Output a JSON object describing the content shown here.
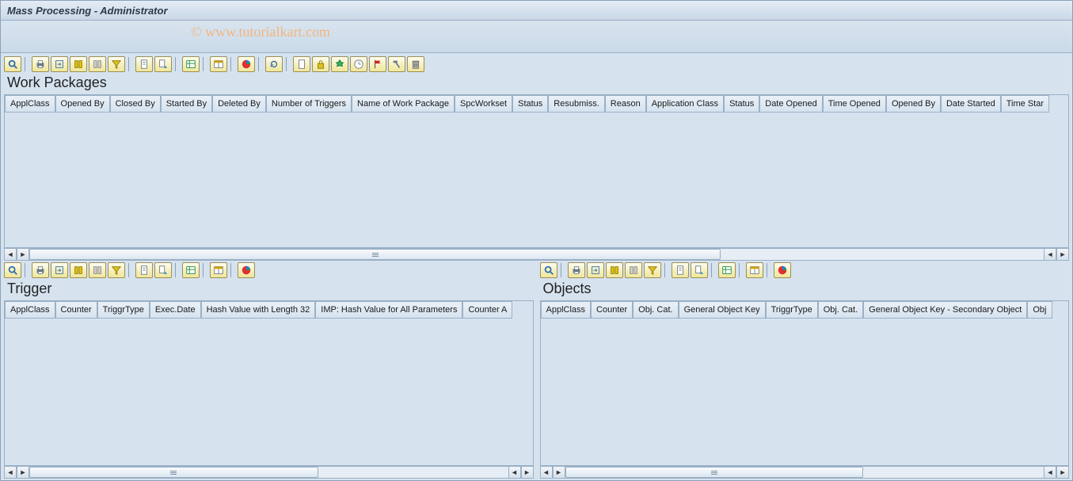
{
  "window_title": "Mass Processing - Administrator",
  "watermark": "© www.tutorialkart.com",
  "panes": {
    "work_packages": {
      "title": "Work Packages",
      "columns": [
        "ApplClass",
        "Opened By",
        "Closed By",
        "Started By",
        "Deleted By",
        "Number of Triggers",
        "Name of Work Package",
        "SpcWorkset",
        "Status",
        "Resubmiss.",
        "Reason",
        "Application Class",
        "Status",
        "Date Opened",
        "Time Opened",
        "Opened By",
        "Date Started",
        "Time Star"
      ]
    },
    "trigger": {
      "title": "Trigger",
      "columns": [
        "ApplClass",
        "Counter",
        "TriggrType",
        "Exec.Date",
        "Hash Value with Length 32",
        "IMP: Hash Value for All Parameters",
        "Counter A"
      ]
    },
    "objects": {
      "title": "Objects",
      "columns": [
        "ApplClass",
        "Counter",
        "Obj. Cat.",
        "General Object Key",
        "TriggrType",
        "Obj. Cat.",
        "General Object Key - Secondary Object",
        "Obj"
      ]
    }
  },
  "toolbar_main": [
    {
      "name": "details-icon",
      "glyph": "details"
    },
    {
      "sep": true
    },
    {
      "name": "print-icon",
      "glyph": "print"
    },
    {
      "name": "export-icon",
      "glyph": "export"
    },
    {
      "name": "find-icon",
      "glyph": "find"
    },
    {
      "name": "find-next-icon",
      "glyph": "findnext"
    },
    {
      "name": "filter-icon",
      "glyph": "filter"
    },
    {
      "sep": true
    },
    {
      "name": "doc-icon",
      "glyph": "doc"
    },
    {
      "name": "doc-send-icon",
      "glyph": "docsend"
    },
    {
      "sep": true
    },
    {
      "name": "sheet-icon",
      "glyph": "sheet"
    },
    {
      "sep": true
    },
    {
      "name": "layout-icon",
      "glyph": "layout"
    },
    {
      "sep": true
    },
    {
      "name": "chart-icon",
      "glyph": "chart"
    },
    {
      "sep": true
    },
    {
      "name": "refresh-icon",
      "glyph": "refresh"
    },
    {
      "sep": true
    },
    {
      "name": "new-icon",
      "glyph": "new"
    },
    {
      "name": "lock-icon",
      "glyph": "lock"
    },
    {
      "name": "process-icon",
      "glyph": "process"
    },
    {
      "name": "schedule-icon",
      "glyph": "schedule"
    },
    {
      "name": "flag-icon",
      "glyph": "flag"
    },
    {
      "name": "hammer-icon",
      "glyph": "hammer"
    },
    {
      "name": "delete-icon",
      "glyph": "delete"
    }
  ],
  "toolbar_small": [
    {
      "name": "details-icon",
      "glyph": "details"
    },
    {
      "sep": true
    },
    {
      "name": "print-icon",
      "glyph": "print"
    },
    {
      "name": "export-icon",
      "glyph": "export"
    },
    {
      "name": "find-icon",
      "glyph": "find"
    },
    {
      "name": "find-next-icon",
      "glyph": "findnext"
    },
    {
      "name": "filter-icon",
      "glyph": "filter"
    },
    {
      "sep": true
    },
    {
      "name": "doc-icon",
      "glyph": "doc"
    },
    {
      "name": "doc-send-icon",
      "glyph": "docsend"
    },
    {
      "sep": true
    },
    {
      "name": "sheet-icon",
      "glyph": "sheet"
    },
    {
      "sep": true
    },
    {
      "name": "layout-icon",
      "glyph": "layout"
    },
    {
      "sep": true
    },
    {
      "name": "chart-icon",
      "glyph": "chart"
    }
  ]
}
